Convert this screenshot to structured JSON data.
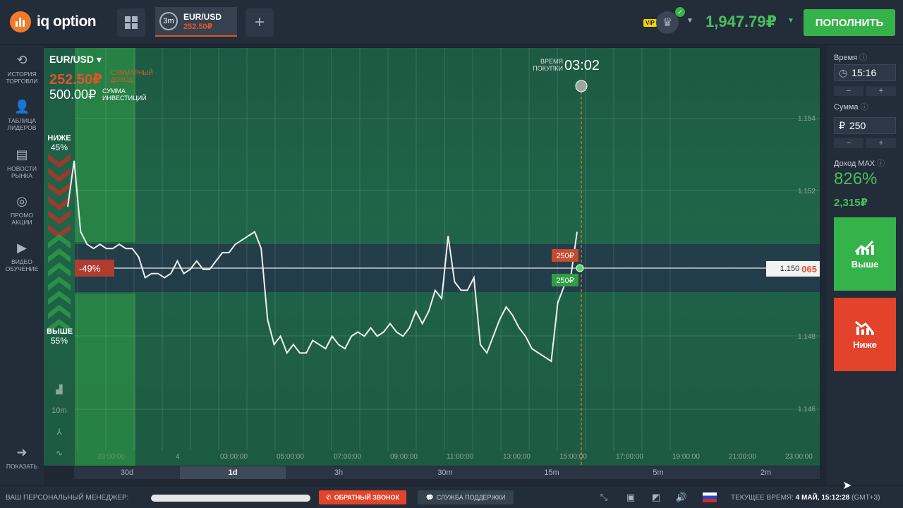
{
  "header": {
    "brand": "iq option",
    "asset_tab": {
      "timeframe": "3m",
      "pair": "EUR/USD",
      "profit": "252.50₽"
    },
    "vip": "VIP",
    "balance": "1,947.79₽",
    "deposit_label": "ПОПОЛНИТЬ"
  },
  "sidebar": {
    "items": [
      {
        "label": "ИСТОРИЯ ТОРГОВЛИ",
        "icon": "history-icon"
      },
      {
        "label": "ТАБЛИЦА ЛИДЕРОВ",
        "icon": "leaders-icon"
      },
      {
        "label": "НОВОСТИ РЫНКА",
        "icon": "news-icon"
      },
      {
        "label": "ПРОМО АКЦИИ",
        "icon": "promo-icon"
      },
      {
        "label": "ВИДЕО ОБУЧЕНИЕ",
        "icon": "video-icon"
      }
    ],
    "show_label": "ПОКАЗАТЬ"
  },
  "chart": {
    "pair": "EUR/USD",
    "total_profit": "252.50₽",
    "total_profit_label": "СУММАРНЫЙ ДОХОД",
    "investment": "500.00₽",
    "investment_label": "СУММА ИНВЕСТИЦИЙ",
    "lower_label": "НИЖЕ",
    "lower_pct": "45%",
    "higher_label": "ВЫШЕ",
    "higher_pct": "55%",
    "diff_badge": "-49%",
    "purchase_time_label": "ВРЕМЯ ПОКУПКИ",
    "purchase_time": "03:02",
    "price_prefix": "1.150",
    "price_suffix": "065",
    "bet_red": "250₽",
    "bet_green": "250₽"
  },
  "chart_data": {
    "type": "line",
    "y_ticks": [
      "1.154",
      "1.152",
      "1.148",
      "1.146"
    ],
    "x_ticks": [
      "4",
      "03:00:00",
      "05:00:00",
      "07:00:00",
      "09:00:00",
      "11:00:00",
      "13:00:00",
      "15:00:00",
      "17:00:00",
      "19:00:00",
      "21:00:00",
      "23:00:00"
    ],
    "x_hidden_tick": "23:00:00",
    "ylim": [
      1.145,
      1.155
    ],
    "current_price": 1.15065,
    "series": [
      {
        "values": [
          1.1512,
          1.1523,
          1.1506,
          1.1503,
          1.1502,
          1.1503,
          1.1502,
          1.1502,
          1.1503,
          1.1502,
          1.1502,
          1.15,
          1.1495,
          1.1496,
          1.1496,
          1.1495,
          1.1496,
          1.1499,
          1.1496,
          1.1497,
          1.1499,
          1.1497,
          1.1497,
          1.1499,
          1.1501,
          1.1501,
          1.1503,
          1.1504,
          1.1505,
          1.1506,
          1.1502,
          1.1485,
          1.1479,
          1.1481,
          1.1477,
          1.1479,
          1.1477,
          1.1477,
          1.148,
          1.1479,
          1.1478,
          1.1481,
          1.1479,
          1.1478,
          1.1481,
          1.1482,
          1.1481,
          1.1483,
          1.1481,
          1.1482,
          1.1484,
          1.1482,
          1.1481,
          1.1483,
          1.1487,
          1.1484,
          1.1487,
          1.1492,
          1.149,
          1.1505,
          1.1494,
          1.1492,
          1.1492,
          1.1495,
          1.1479,
          1.1477,
          1.1481,
          1.1485,
          1.1488,
          1.1486,
          1.1483,
          1.1481,
          1.1478,
          1.1477,
          1.1476,
          1.1475,
          1.1489,
          1.1493,
          1.1495,
          1.1506
        ]
      }
    ]
  },
  "timeframes": [
    "30d",
    "1d",
    "3h",
    "30m",
    "15m",
    "5m",
    "2m"
  ],
  "active_timeframe": "1d",
  "right_panel": {
    "time_label": "Время",
    "time_value": "15:16",
    "amount_label": "Сумма",
    "currency": "₽",
    "amount_value": "250",
    "minus": "−",
    "plus": "+",
    "max_profit_label": "Доход MAX",
    "max_profit_pct": "826%",
    "max_profit_value": "2,315₽",
    "up_label": "Выше",
    "down_label": "Ниже"
  },
  "bottombar": {
    "manager_label": "ВАШ ПЕРСОНАЛЬНЫЙ МЕНЕДЖЕР:",
    "callback_label": "ОБРАТНЫЙ ЗВОНОК",
    "support_label": "СЛУЖБА ПОДДЕРЖКИ",
    "current_time_label": "ТЕКУЩЕЕ ВРЕМЯ:",
    "current_time_value": "4 МАЙ, 15:12:28",
    "timezone": "(GMT+3)"
  },
  "colors": {
    "accent_green": "#36b24a",
    "accent_red": "#e2432a",
    "profit_orange": "#e2532a",
    "bg_dark": "#232c39"
  }
}
